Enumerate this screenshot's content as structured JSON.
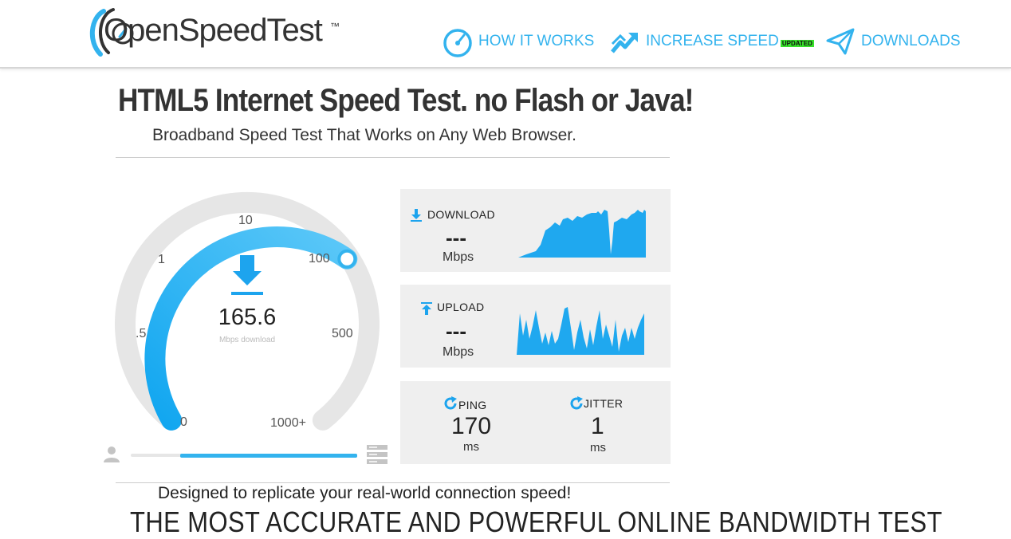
{
  "header": {
    "logo_text": "OpenSpeedTest",
    "logo_tm": "™",
    "nav": [
      {
        "label": "HOW IT WORKS",
        "icon": "speedometer-icon"
      },
      {
        "label": "INCREASE SPEED",
        "icon": "trend-arrow-icon",
        "badge": "UPDATED"
      },
      {
        "label": "DOWNLOADS",
        "icon": "paper-plane-icon"
      }
    ]
  },
  "hero": {
    "title": "HTML5 Internet Speed Test. no Flash or Java!",
    "subtitle": "Broadband Speed Test That Works on Any Web Browser."
  },
  "gauge": {
    "value": "165.6",
    "unit": "Mbps download",
    "ticks": [
      "0",
      ".5",
      "1",
      "10",
      "100",
      "500",
      "1000+"
    ],
    "colors": {
      "accent": "#33b3ee",
      "track": "#e6e6e6"
    },
    "progress_fraction": 0.78
  },
  "panels": {
    "download": {
      "label": "DOWNLOAD",
      "value": "---",
      "unit": "Mbps"
    },
    "upload": {
      "label": "UPLOAD",
      "value": "---",
      "unit": "Mbps"
    },
    "ping": {
      "label": "PING",
      "value": "170",
      "unit": "ms"
    },
    "jitter": {
      "label": "JITTER",
      "value": "1",
      "unit": "ms"
    }
  },
  "footer": {
    "tagline": "Designed to replicate your real-world connection speed!",
    "heading": "THE MOST ACCURATE AND POWERFUL ONLINE BANDWIDTH TEST"
  }
}
